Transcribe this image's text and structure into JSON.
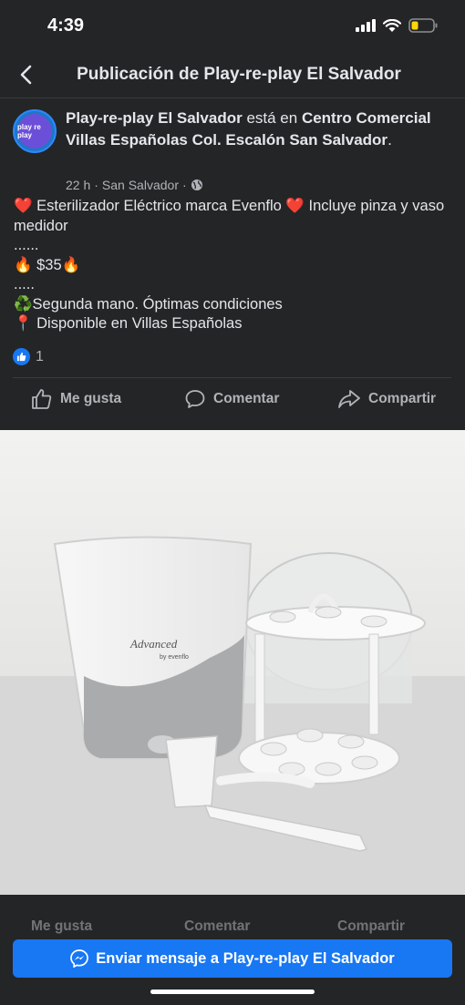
{
  "status_bar": {
    "time": "4:39"
  },
  "nav": {
    "title": "Publicación de Play-re-play El Salvador"
  },
  "post": {
    "page_name": "Play-re-play El Salvador",
    "is_at": "está en",
    "location": "Centro Comercial Villas Españolas Col. Escalón San Salvador",
    "period": ".",
    "avatar_text": "play re play",
    "time": "22 h",
    "place": "San Salvador",
    "dot": "·",
    "body": {
      "line1_prefix": "❤️",
      "line1_text": " Esterilizador Eléctrico marca Evenflo ",
      "line1_heart": "❤️",
      "line1_rest": " Incluye pinza y vaso medidor",
      "dots1": "......",
      "price": "🔥 $35🔥",
      "dots2": ".....",
      "condition": "♻️Segunda mano. Óptimas condiciones",
      "availability": "📍 Disponible en Villas Españolas"
    },
    "reaction_count": "1"
  },
  "actions": {
    "like": "Me gusta",
    "comment": "Comentar",
    "share": "Compartir"
  },
  "photo": {
    "product_brand": "Advanced",
    "product_sub": "by evenflo"
  },
  "messenger_button": {
    "label": "Enviar mensaje a Play-re-play El Salvador"
  },
  "colors": {
    "background": "#242526",
    "accent": "#1877f2",
    "heart": "#e41e3f"
  }
}
